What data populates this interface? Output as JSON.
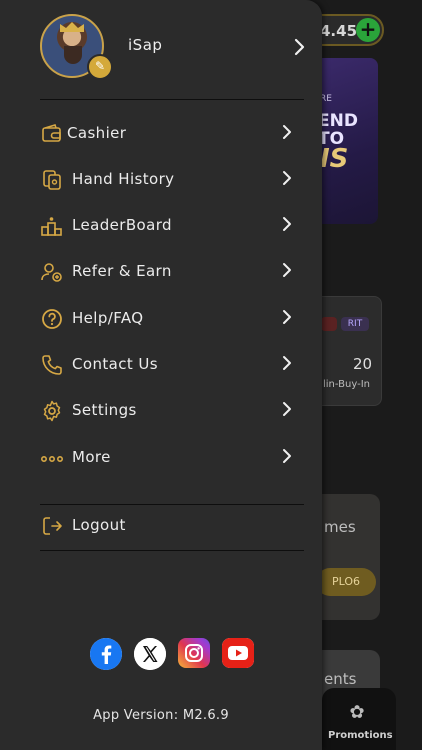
{
  "background": {
    "balance_text": "4.45",
    "banner_line1": "RE",
    "banner_line2": "END\nTO",
    "banner_line3": "IS",
    "card_chip": "RIT",
    "card_value": "20",
    "card_caption": "lin-Buy-In",
    "games_label": "mes",
    "games_code": "PLO6",
    "events_label": "ents",
    "promotions_label": "Promotions"
  },
  "profile": {
    "username": "iSap"
  },
  "menu": {
    "items": [
      {
        "label": "Cashier",
        "icon": "wallet-icon"
      },
      {
        "label": "Hand History",
        "icon": "hand-history-icon"
      },
      {
        "label": "LeaderBoard",
        "icon": "podium-icon"
      },
      {
        "label": "Refer & Earn",
        "icon": "refer-icon"
      },
      {
        "label": "Help/FAQ",
        "icon": "help-icon"
      },
      {
        "label": "Contact Us",
        "icon": "phone-icon"
      },
      {
        "label": "Settings",
        "icon": "gear-icon"
      },
      {
        "label": "More",
        "icon": "more-dots-icon"
      }
    ],
    "logout_label": "Logout"
  },
  "socials": [
    "facebook-icon",
    "x-icon",
    "instagram-icon",
    "youtube-icon"
  ],
  "version_text": "App Version: M2.6.9",
  "colors": {
    "drawer_bg": "#2b2b2b",
    "accent_gold": "#d6a845",
    "page_bg": "#1a1a1a"
  }
}
